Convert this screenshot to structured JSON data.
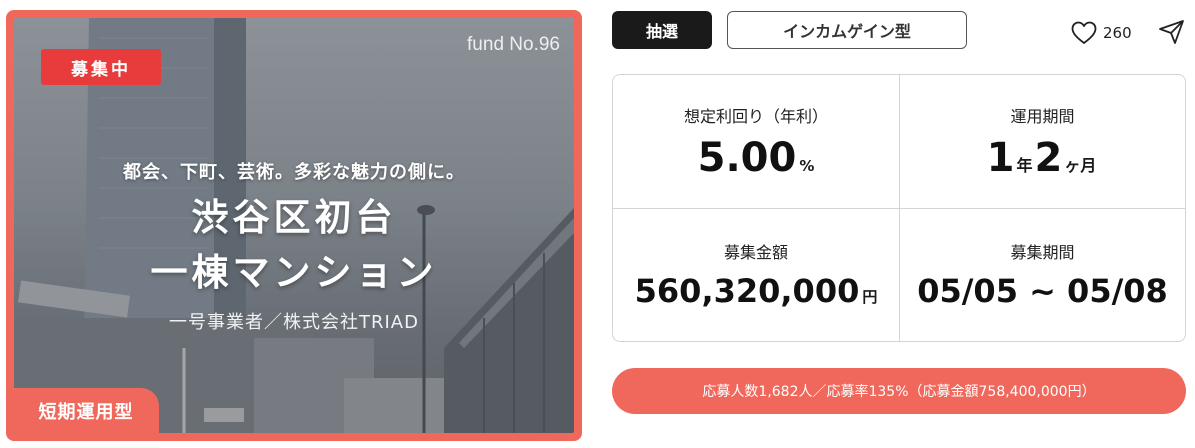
{
  "card": {
    "status_badge": "募集中",
    "fund_no": "fund No.96",
    "catchphrase": "都会、下町、芸術。多彩な魅力の側に。",
    "title_line1": "渋谷区初台",
    "title_line2": "一棟マンション",
    "operator": "一号事業者／株式会社TRIAD",
    "term_badge": "短期運用型"
  },
  "tags": {
    "lottery": "抽選",
    "income_type": "インカムゲイン型"
  },
  "favorite": {
    "icon": "heart-icon",
    "count": "260"
  },
  "share": {
    "icon": "paper-plane-icon"
  },
  "stats": {
    "yield_label": "想定利回り（年利）",
    "yield_value": "5.00",
    "yield_unit": "%",
    "period_label": "運用期間",
    "period_years": "1",
    "period_year_unit": "年",
    "period_months": "2",
    "period_month_unit": "ヶ月",
    "amount_label": "募集金額",
    "amount_value": "560,320,000",
    "amount_unit": "円",
    "recruit_label": "募集期間",
    "recruit_value": "05/05 ~ 05/08"
  },
  "applicants_text": "応募人数1,682人／応募率135%（応募金額758,400,000円）",
  "colors": {
    "accent": "#f0675c",
    "badge_red": "#e83b3b",
    "dark": "#1a1a1a"
  }
}
